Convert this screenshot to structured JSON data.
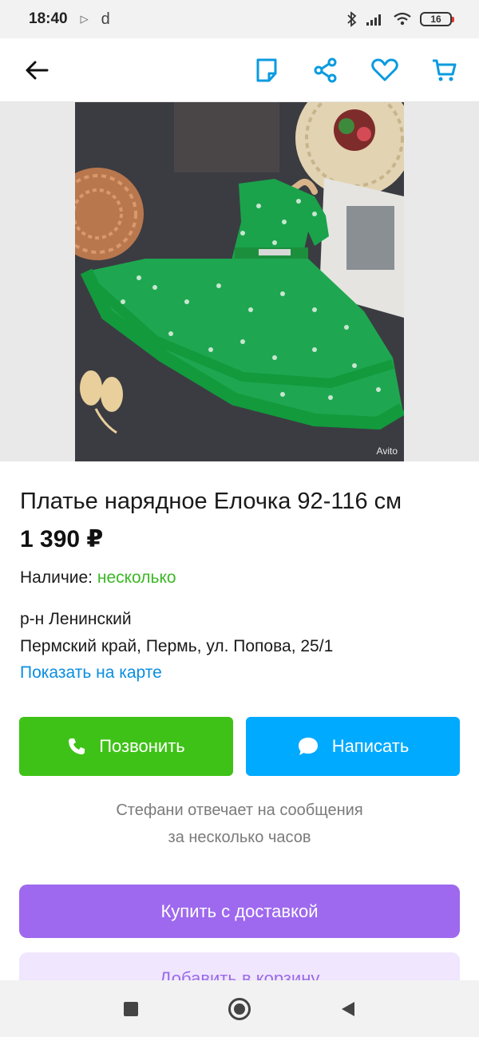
{
  "status_bar": {
    "time": "18:40",
    "letter": "d",
    "battery": "16"
  },
  "top_bar": {
    "icons": [
      "back-arrow-icon",
      "note-icon",
      "share-icon",
      "heart-icon",
      "cart-icon"
    ],
    "accent_color": "#0a9be0"
  },
  "photo": {
    "watermark": "Avito"
  },
  "listing": {
    "title": "Платье нарядное Елочка 92-116 см",
    "price": "1 390 ₽",
    "availability_label": "Наличие:",
    "availability_value": "несколько",
    "district": "р-н Ленинский",
    "address": "Пермский край, Пермь, ул. Попова, 25/1",
    "map_link": "Показать на карте"
  },
  "actions": {
    "call_label": "Позвонить",
    "write_label": "Написать",
    "reply_note_line1": "Стефани отвечает на сообщения",
    "reply_note_line2": "за несколько часов",
    "buy_label": "Купить с доставкой",
    "cart_label": "Добавить в корзину"
  },
  "colors": {
    "green": "#3fc217",
    "blue": "#00aaff",
    "purple": "#9e69ee",
    "link": "#0a8ee0",
    "availability": "#3cb825"
  },
  "nav_bar": {
    "icons": [
      "square-icon",
      "home-circle-icon",
      "back-triangle-icon"
    ]
  }
}
